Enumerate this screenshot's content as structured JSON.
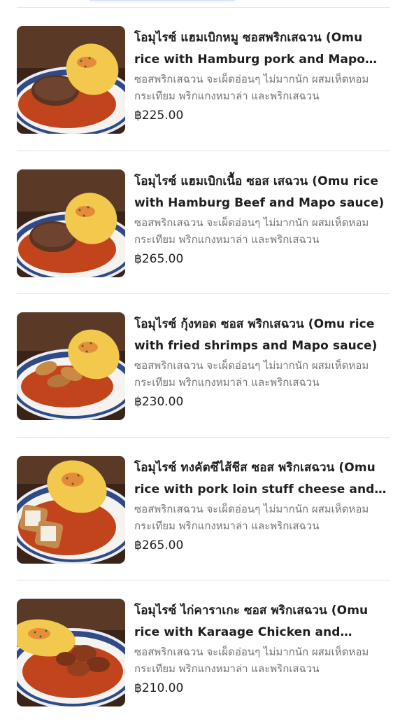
{
  "menu_items": [
    {
      "name": "โอมุไรซ์ แฮมเบิกหมู ซอสพริกเสฉวน (Omu rice with Hamburg pork and Mapo…",
      "description": "ซอสพริกเสฉวน จะเผ็ดอ่อนๆ ไม่มากนัก ผสมเห็ดหอม กระเทียม พริกแกงหมาล่า และพริกเสฉวน",
      "price": "฿225.00",
      "image_icon": "omurice-hamburg-photo"
    },
    {
      "name": "โอมุไรซ์ แฮมเบิกเนื้อ ซอส เสฉวน (Omu rice with Hamburg Beef and Mapo sauce)",
      "description": "ซอสพริกเสฉวน จะเผ็ดอ่อนๆ ไม่มากนัก ผสมเห็ดหอม กระเทียม พริกแกงหมาล่า และพริกเสฉวน",
      "price": "฿265.00",
      "image_icon": "omurice-hamburg-beef-photo"
    },
    {
      "name": "โอมุไรซ์ กุ้งทอด ซอส พริกเสฉวน (Omu rice with fried shrimps and Mapo sauce)",
      "description": "ซอสพริกเสฉวน จะเผ็ดอ่อนๆ ไม่มากนัก ผสมเห็ดหอม กระเทียม พริกแกงหมาล่า และพริกเสฉวน",
      "price": "฿230.00",
      "image_icon": "omurice-fried-shrimp-photo"
    },
    {
      "name": "โอมุไรซ์ ทงคัตซึไส้ชีส ซอส พริกเสฉวน (Omu rice with pork loin stuff cheese and…",
      "description": "ซอสพริกเสฉวน จะเผ็ดอ่อนๆ ไม่มากนัก ผสมเห็ดหอม กระเทียม พริกแกงหมาล่า และพริกเสฉวน",
      "price": "฿265.00",
      "image_icon": "omurice-tonkatsu-cheese-photo"
    },
    {
      "name": "โอมุไรซ์ ไก่คาราเกะ ซอส พริกเสฉวน (Omu rice with Karaage Chicken and Mapo…",
      "description": "ซอสพริกเสฉวน จะเผ็ดอ่อนๆ ไม่มากนัก ผสมเห็ดหอม กระเทียม พริกแกงหมาล่า และพริกเสฉวน",
      "price": "฿210.00",
      "image_icon": "omurice-karaage-photo"
    }
  ],
  "colors": {
    "text_primary": "#1f1f1f",
    "text_secondary": "#747474",
    "divider": "#e2e2e2",
    "sauce": "#c2441c",
    "omelette": "#f2c94c"
  }
}
